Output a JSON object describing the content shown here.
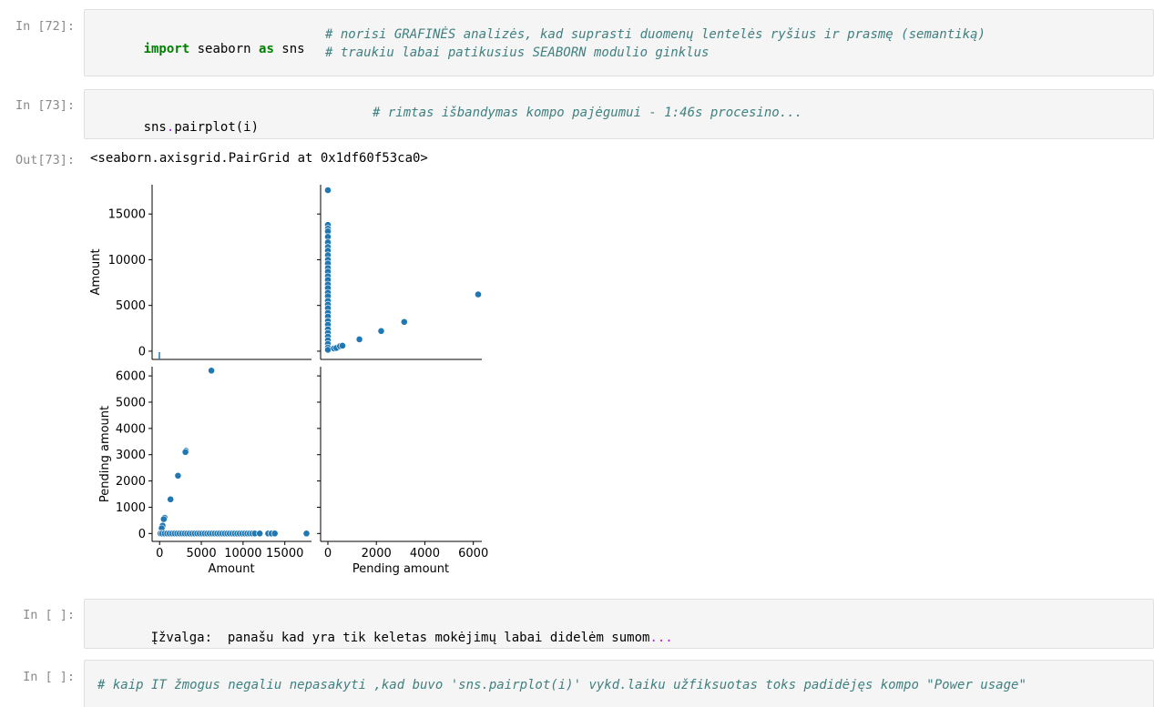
{
  "cells": [
    {
      "prompt": "In [72]:",
      "lines": [
        {
          "code_parts": [
            "import",
            " seaborn ",
            "as",
            " sns"
          ],
          "comment": "# norisi GRAFINĖS analizės, kad suprasti duomenų lentelės ryšius ir prasmę (semantiką)"
        },
        {
          "comment": "# traukiu labai patikusius SEABORN modulio ginklus"
        }
      ]
    },
    {
      "prompt": "In [73]:",
      "code": [
        "sns",
        ".",
        "pairplot(i)"
      ],
      "comment": "# rimtas išbandymas kompo pajėgumui - 1:46s procesino..."
    },
    {
      "out_prompt": "Out[73]:",
      "output": "<seaborn.axisgrid.PairGrid at 0x1df60f53ca0>"
    },
    {
      "prompt": "In [ ]:",
      "text": "Įžvalga:  panašu kad yra tik keletas mokėjimų labai didelėm sumom",
      "dots": "..."
    },
    {
      "prompt": "In [ ]:",
      "comment": "# kaip IT žmogus negaliu nepasakyti ,kad buvo 'sns.pairplot(i)' vykd.laiku užfiksuotas toks padidėjęs kompo \"Power usage\""
    }
  ],
  "chart_data": {
    "type": "scatter",
    "variables": [
      "Amount",
      "Pending amount"
    ],
    "marker_color": "#1f77b4",
    "panels": [
      {
        "name": "Amount vs Pending amount (top-right)",
        "x_var": "Pending amount",
        "y_var": "Amount",
        "xlim": [
          -300,
          6350
        ],
        "ylim": [
          -900,
          18200
        ],
        "xticks": [
          0,
          2000,
          4000,
          6000
        ],
        "yticks": [
          0,
          5000,
          10000,
          15000
        ],
        "points": [
          [
            0,
            17600
          ],
          [
            0,
            13800
          ],
          [
            0,
            13400
          ],
          [
            0,
            13100
          ],
          [
            0,
            12500
          ],
          [
            0,
            11900
          ],
          [
            0,
            11400
          ],
          [
            0,
            11000
          ],
          [
            0,
            10500
          ],
          [
            0,
            10000
          ],
          [
            0,
            9600
          ],
          [
            0,
            9100
          ],
          [
            0,
            8700
          ],
          [
            0,
            8200
          ],
          [
            0,
            7800
          ],
          [
            0,
            7300
          ],
          [
            0,
            6900
          ],
          [
            0,
            6400
          ],
          [
            0,
            6000
          ],
          [
            0,
            5500
          ],
          [
            0,
            5100
          ],
          [
            0,
            4700
          ],
          [
            0,
            4200
          ],
          [
            0,
            3800
          ],
          [
            0,
            3300
          ],
          [
            0,
            2900
          ],
          [
            0,
            2400
          ],
          [
            0,
            2000
          ],
          [
            0,
            1600
          ],
          [
            0,
            1200
          ],
          [
            0,
            800
          ],
          [
            0,
            400
          ],
          [
            0,
            150
          ],
          [
            250,
            300
          ],
          [
            350,
            350
          ],
          [
            500,
            550
          ],
          [
            600,
            600
          ],
          [
            1300,
            1300
          ],
          [
            2200,
            2200
          ],
          [
            3150,
            3200
          ],
          [
            6200,
            6200
          ]
        ]
      },
      {
        "name": "Pending amount vs Amount (bottom-left)",
        "x_var": "Amount",
        "y_var": "Pending amount",
        "xlim": [
          -900,
          18200
        ],
        "ylim": [
          -300,
          6350
        ],
        "xticks": [
          0,
          5000,
          10000,
          15000
        ],
        "yticks": [
          0,
          1000,
          2000,
          3000,
          4000,
          5000,
          6000
        ],
        "points": [
          [
            6200,
            6200
          ],
          [
            3150,
            3150
          ],
          [
            3100,
            3100
          ],
          [
            2200,
            2200
          ],
          [
            1300,
            1300
          ],
          [
            600,
            600
          ],
          [
            500,
            550
          ],
          [
            350,
            300
          ],
          [
            250,
            200
          ],
          [
            100,
            0
          ],
          [
            300,
            0
          ],
          [
            600,
            0
          ],
          [
            900,
            0
          ],
          [
            1200,
            0
          ],
          [
            1500,
            0
          ],
          [
            1800,
            0
          ],
          [
            2100,
            0
          ],
          [
            2400,
            0
          ],
          [
            2700,
            0
          ],
          [
            3000,
            0
          ],
          [
            3300,
            0
          ],
          [
            3600,
            0
          ],
          [
            3900,
            0
          ],
          [
            4200,
            0
          ],
          [
            4500,
            0
          ],
          [
            4800,
            0
          ],
          [
            5100,
            0
          ],
          [
            5400,
            0
          ],
          [
            5700,
            0
          ],
          [
            6000,
            0
          ],
          [
            6300,
            0
          ],
          [
            6600,
            0
          ],
          [
            6900,
            0
          ],
          [
            7200,
            0
          ],
          [
            7500,
            0
          ],
          [
            7800,
            0
          ],
          [
            8100,
            0
          ],
          [
            8400,
            0
          ],
          [
            8700,
            0
          ],
          [
            9000,
            0
          ],
          [
            9300,
            0
          ],
          [
            9600,
            0
          ],
          [
            9900,
            0
          ],
          [
            10200,
            0
          ],
          [
            10500,
            0
          ],
          [
            10800,
            0
          ],
          [
            11100,
            0
          ],
          [
            11400,
            0
          ],
          [
            12000,
            0
          ],
          [
            13000,
            0
          ],
          [
            13400,
            0
          ],
          [
            13800,
            0
          ],
          [
            17600,
            0
          ]
        ]
      }
    ]
  }
}
